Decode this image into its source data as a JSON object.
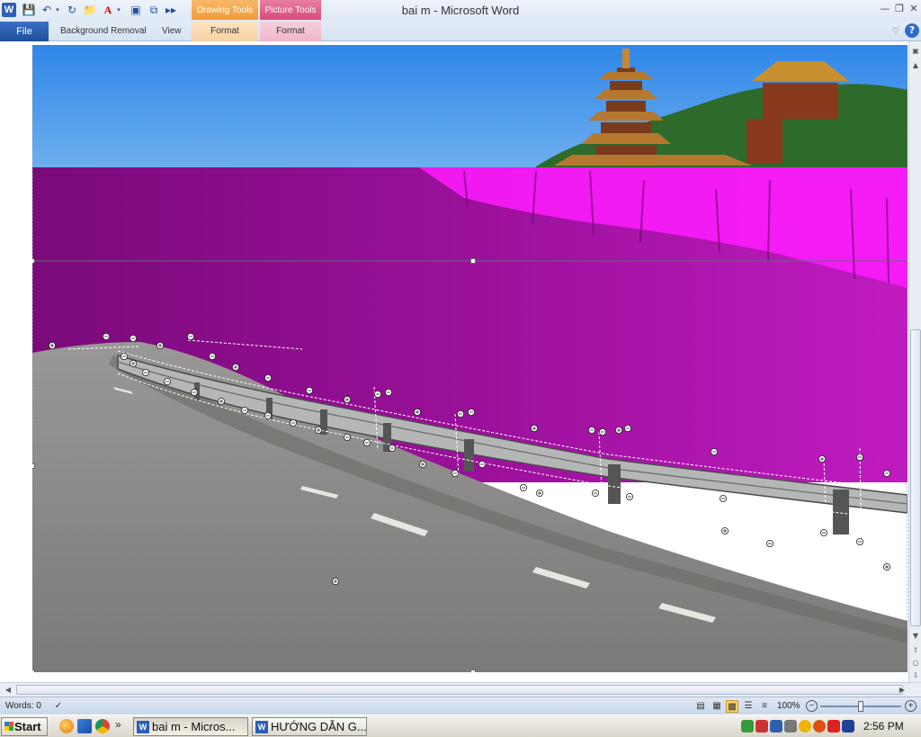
{
  "window": {
    "title": "bai m  -  Microsoft Word",
    "app_icon": "word-icon"
  },
  "quick_access": {
    "icons": [
      "save-icon",
      "undo-icon",
      "redo-icon",
      "insert-picture-icon",
      "font-color-icon",
      "image-icon",
      "copy-format-icon",
      "more-icon"
    ]
  },
  "context_tabs": {
    "drawing_tools": "Drawing Tools",
    "picture_tools": "Picture Tools",
    "drawing_color": "#f29b36",
    "picture_color": "#d64b7a"
  },
  "ribbon": {
    "file_label": "File",
    "background_removal_label": "Background Removal",
    "view_label": "View",
    "drawing_format_label": "Format",
    "picture_format_label": "Format"
  },
  "status": {
    "words": "Words: 0",
    "zoom": "100%"
  },
  "taskbar": {
    "start_label": "Start",
    "chevron": "»",
    "task1": "bai m - Micros...",
    "task2": "HƯỚNG DẪN G...",
    "clock": "2:56 PM"
  },
  "colors": {
    "removal_overlay": "#ff00ff",
    "sky": "#3f8fe6",
    "road": "#8c8a87"
  }
}
